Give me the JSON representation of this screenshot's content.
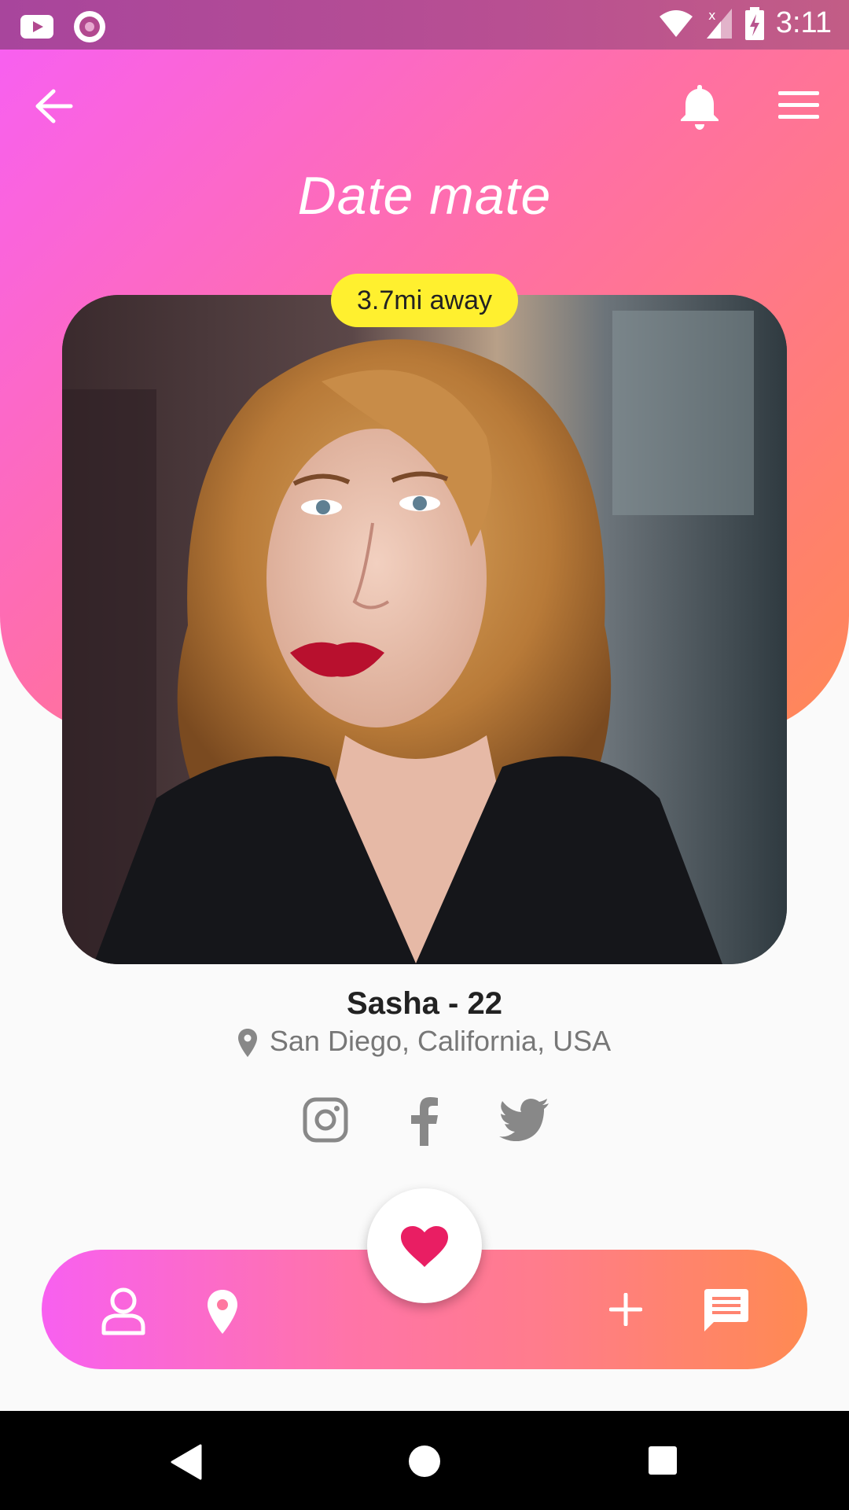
{
  "status_bar": {
    "time": "3:11",
    "icons": [
      "youtube-icon",
      "record-icon",
      "wifi-icon",
      "signal-icon",
      "battery-charging-icon"
    ]
  },
  "toolbar": {
    "back_icon": "arrow-left-icon",
    "notification_icon": "bell-icon",
    "menu_icon": "hamburger-menu-icon"
  },
  "app_title": "Date mate",
  "profile": {
    "distance": "3.7mi away",
    "name_age": "Sasha - 22",
    "location": "San Diego, California, USA",
    "photo": "profile-photo"
  },
  "social": [
    "instagram-icon",
    "facebook-icon",
    "twitter-icon"
  ],
  "bottom_nav": {
    "items": [
      "profile-icon",
      "location-pin-icon",
      "plus-icon",
      "chat-icon"
    ],
    "fab_icon": "heart-icon"
  },
  "colors": {
    "gradient_start": "#f860f0",
    "gradient_end": "#ff8855",
    "badge": "#fff02f",
    "heart": "#e91e63",
    "text_dark": "#222222",
    "text_muted": "#777777",
    "social_icon": "#888888"
  }
}
